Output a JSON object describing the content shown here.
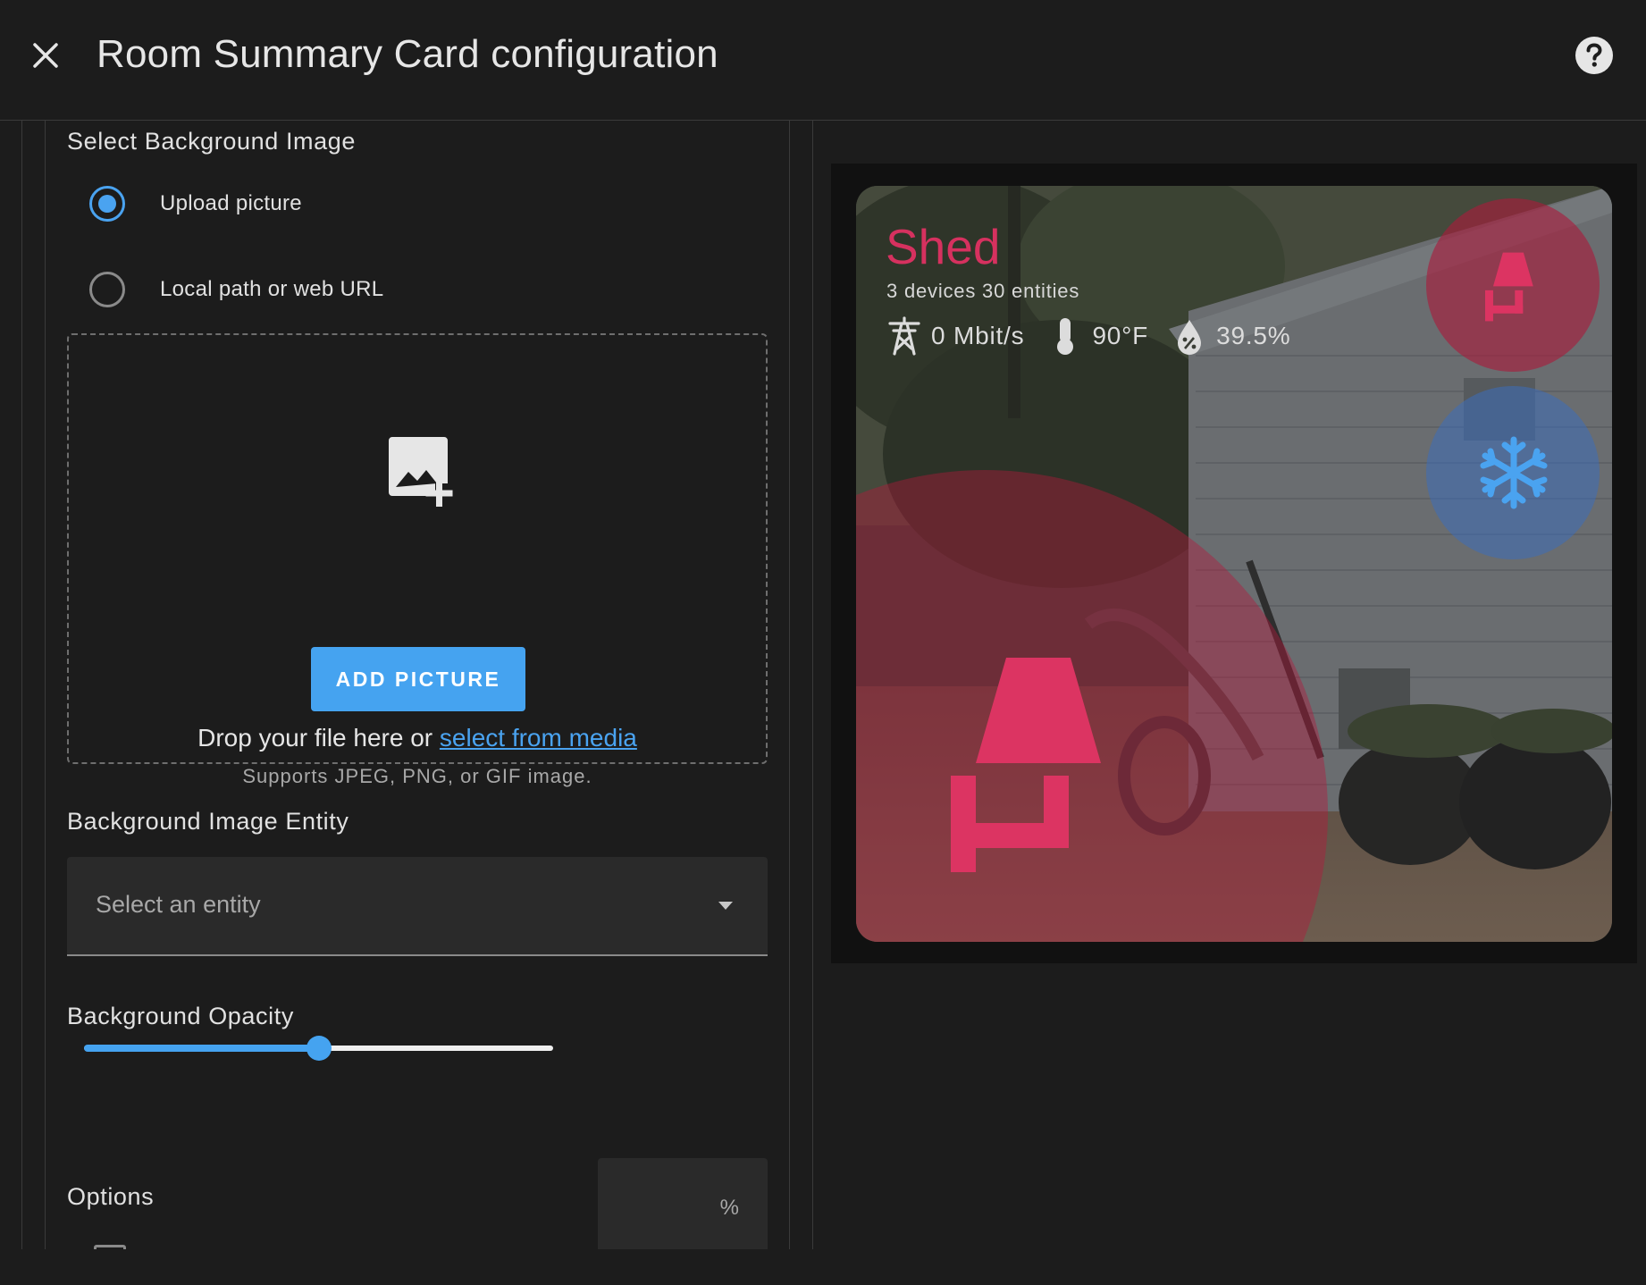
{
  "header": {
    "title": "Room Summary Card configuration",
    "close_icon": "close-icon",
    "help_icon": "help-circle-icon"
  },
  "editor": {
    "bg_image_section": {
      "label": "Select Background Image",
      "options": [
        {
          "label": "Upload picture",
          "checked": true
        },
        {
          "label": "Local path or web URL",
          "checked": false
        }
      ],
      "upload": {
        "icon": "image-plus-icon",
        "button_label": "ADD PICTURE",
        "drop_text": "Drop your file here or",
        "media_link": "select from media",
        "support_text": "Supports JPEG, PNG, or GIF image."
      }
    },
    "bg_entity": {
      "label": "Background Image Entity",
      "placeholder": "Select an entity"
    },
    "bg_opacity": {
      "label": "Background Opacity",
      "slider_value_percent": 50,
      "input_value": "",
      "unit": "%"
    },
    "options": {
      "label": "Options"
    }
  },
  "preview": {
    "room_name": "Shed",
    "subtitle": "3 devices 30 entities",
    "stats": [
      {
        "icon": "transmission-tower-icon",
        "value": "0 Mbit/s"
      },
      {
        "icon": "thermometer-icon",
        "value": "90°F"
      },
      {
        "icon": "water-percent-icon",
        "value": "39.5%"
      }
    ],
    "main_icon": "floor-lamp-icon",
    "entities": [
      {
        "icon": "floor-lamp-icon",
        "state": "on"
      },
      {
        "icon": "snowflake-icon",
        "state": "cool"
      }
    ],
    "colors": {
      "accent": "#d6315f",
      "primary": "#45a3f0",
      "cool": "#4aa3f0"
    }
  }
}
